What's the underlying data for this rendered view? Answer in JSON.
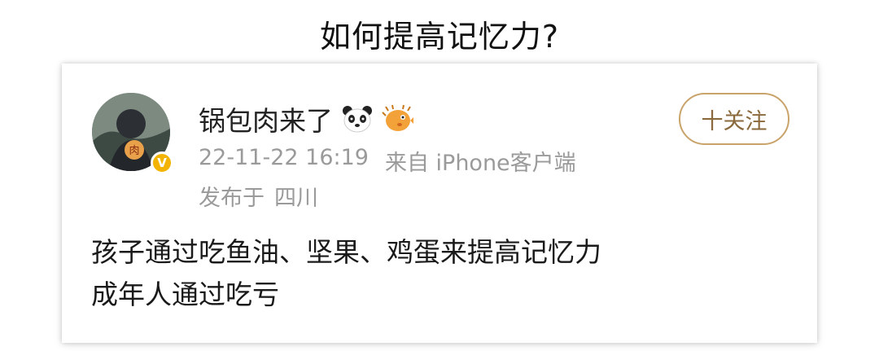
{
  "headline": "如何提高记忆力?",
  "post": {
    "username": "锅包肉来了",
    "emoji_icons": [
      "panda-face-icon",
      "pufferfish-icon"
    ],
    "timestamp": "22-11-22 16:19",
    "source": "来自 iPhone客户端",
    "location_label": "发布于",
    "location": "四川",
    "follow_label": "十关注",
    "verified_badge": "V",
    "body_lines": [
      "孩子通过吃鱼油、坚果、鸡蛋来提高记忆力",
      "成年人通过吃亏"
    ]
  },
  "colors": {
    "verified_badge": "#f2b400",
    "follow_border": "#c9a36a",
    "meta_text": "#9a9a9a"
  }
}
